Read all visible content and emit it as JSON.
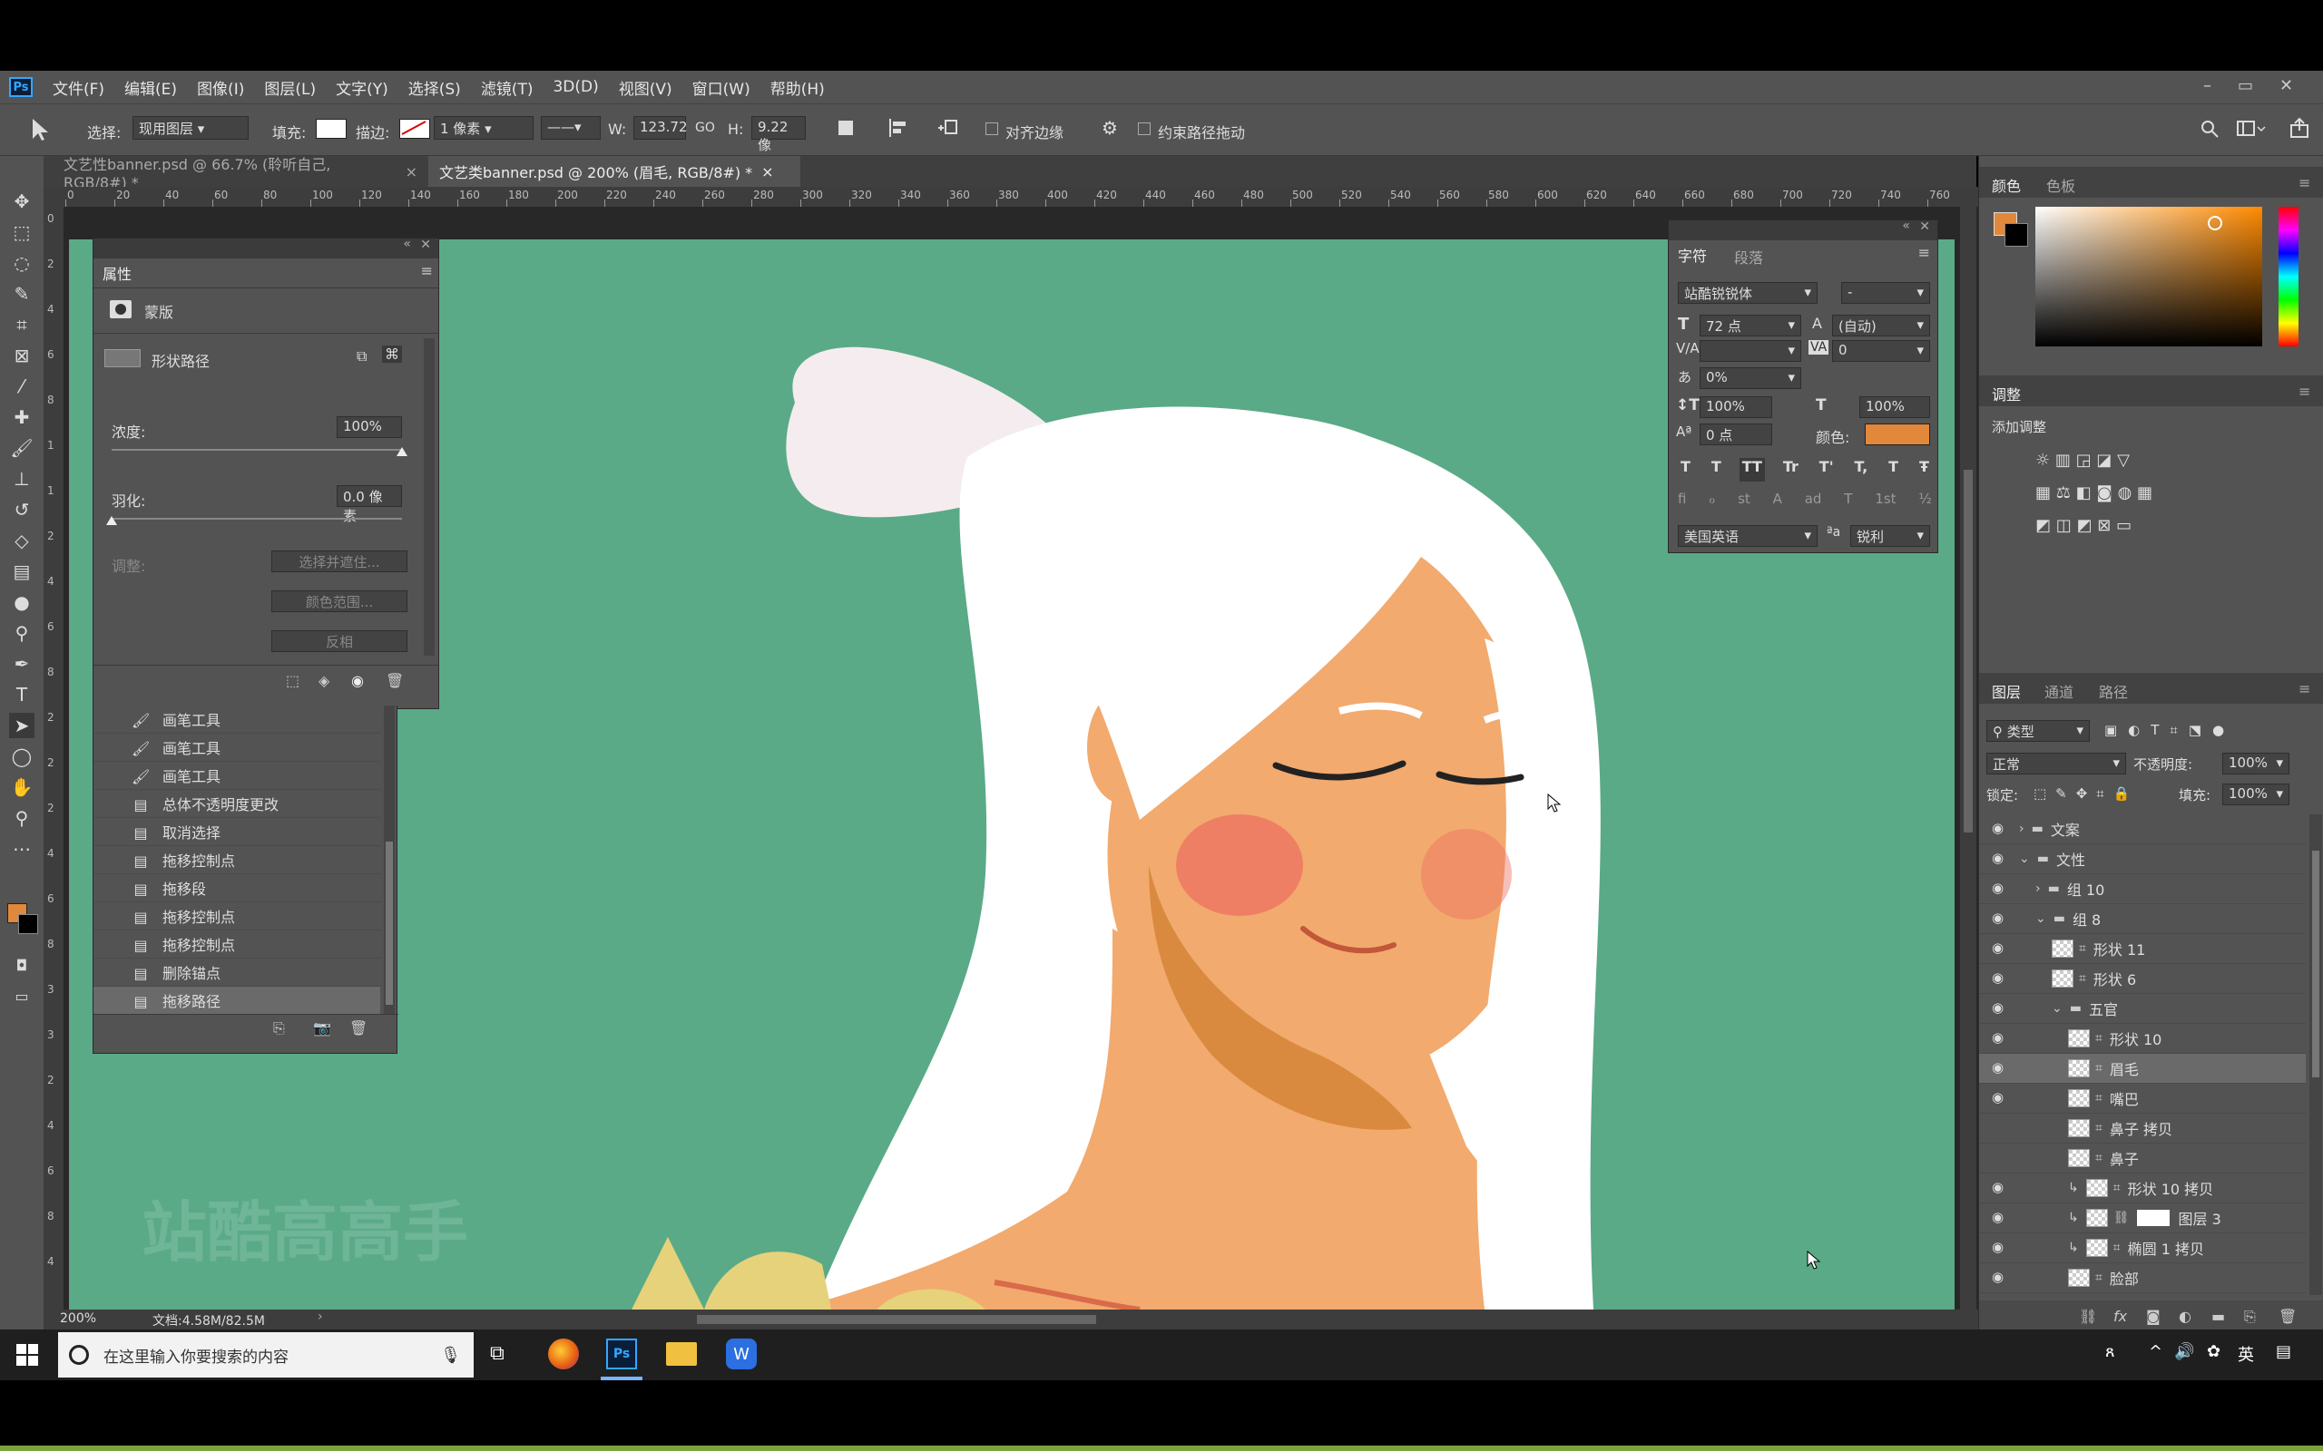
{
  "menu": {
    "app_icon": "Ps",
    "items": [
      "文件(F)",
      "编辑(E)",
      "图像(I)",
      "图层(L)",
      "文字(Y)",
      "选择(S)",
      "滤镜(T)",
      "3D(D)",
      "视图(V)",
      "窗口(W)",
      "帮助(H)"
    ],
    "window_controls": [
      "–",
      "▭",
      "✕"
    ]
  },
  "options": {
    "select_label": "选择:",
    "select_value": "现用图层",
    "fill_label": "填充:",
    "stroke_label": "描边:",
    "stroke_width": "1 像素",
    "w_label": "W:",
    "w_value": "123.72",
    "link": "GO",
    "h_label": "H:",
    "h_value": "9.22 像",
    "align_edges": "对齐边缘",
    "constrain_path": "约束路径拖动"
  },
  "tabs": [
    {
      "label": "文艺性banner.psd @ 66.7% (聆听自己, RGB/8#) *",
      "close": "×"
    },
    {
      "label": "文艺类banner.psd @ 200% (眉毛, RGB/8#) *",
      "close": "×"
    }
  ],
  "ruler_h": [
    "0",
    "20",
    "40",
    "60",
    "80",
    "100",
    "120",
    "140",
    "160",
    "180",
    "200",
    "220",
    "240",
    "260",
    "280",
    "300",
    "320",
    "340",
    "360",
    "380",
    "400",
    "420",
    "440",
    "460",
    "480",
    "500",
    "520",
    "540",
    "560",
    "580",
    "600",
    "620",
    "640",
    "660",
    "680",
    "700",
    "720",
    "740",
    "760"
  ],
  "ruler_v": [
    "0",
    "2",
    "4",
    "6",
    "8",
    "1",
    "1",
    "2",
    "4",
    "6",
    "8",
    "2",
    "2",
    "2",
    "4",
    "6",
    "8",
    "3",
    "3",
    "2",
    "4",
    "6",
    "8",
    "4"
  ],
  "properties": {
    "title": "属性",
    "mask_label": "蒙版",
    "shape_path": "形状路径",
    "density_label": "浓度:",
    "density_value": "100%",
    "density_fraction": 1.0,
    "feather_label": "羽化:",
    "feather_value": "0.0 像素",
    "feather_fraction": 0.0,
    "adjust_label": "调整:",
    "btn_select_mask": "选择并遮住...",
    "btn_color_range": "颜色范围...",
    "btn_invert": "反相"
  },
  "history": {
    "items": [
      "画笔工具",
      "画笔工具",
      "画笔工具",
      "总体不透明度更改",
      "取消选择",
      "拖移控制点",
      "拖移段",
      "拖移控制点",
      "拖移控制点",
      "删除锚点",
      "拖移路径"
    ],
    "selected_index": 10
  },
  "character": {
    "tab_char": "字符",
    "tab_para": "段落",
    "font_family": "站酷锐锐体",
    "font_style": "-",
    "font_size": "72 点",
    "leading": "(自动)",
    "kerning": "",
    "tracking": "0",
    "tsume": "0%",
    "vscale": "100%",
    "hscale": "100%",
    "baseline": "0 点",
    "color_label": "颜色:",
    "color_hex": "#e2883a",
    "styles": [
      "T",
      "T",
      "TT",
      "Tr",
      "T'",
      "T,",
      "T",
      "Ŧ"
    ],
    "ot_features": [
      "fi",
      "ℴ",
      "st",
      "A",
      "ad",
      "T",
      "1st",
      "½"
    ],
    "language": "美国英语",
    "aa_icon": "ªa",
    "aa_mode": "锐利"
  },
  "color_panel": {
    "tab_color": "颜色",
    "tab_swatch": "色板",
    "foreground": "#e2883a",
    "background": "#000000"
  },
  "adjustments": {
    "title": "调整",
    "add_label": "添加调整"
  },
  "layers": {
    "tab_layers": "图层",
    "tab_channels": "通道",
    "tab_paths": "路径",
    "filter_kind": "类型",
    "blend_mode": "正常",
    "opacity_label": "不透明度:",
    "opacity_value": "100%",
    "lock_label": "锁定:",
    "fill_label": "填充:",
    "fill_value": "100%",
    "items": [
      {
        "name": "文案",
        "type": "group",
        "indent": 0,
        "visible": true,
        "expanded": false
      },
      {
        "name": "文性",
        "type": "group",
        "indent": 0,
        "visible": true,
        "expanded": true
      },
      {
        "name": "组 10",
        "type": "group",
        "indent": 1,
        "visible": true,
        "expanded": false
      },
      {
        "name": "组 8",
        "type": "group",
        "indent": 1,
        "visible": true,
        "expanded": true
      },
      {
        "name": "形状 11",
        "type": "shape",
        "indent": 2,
        "visible": true
      },
      {
        "name": "形状 6",
        "type": "shape",
        "indent": 2,
        "visible": true
      },
      {
        "name": "五官",
        "type": "group",
        "indent": 2,
        "visible": true,
        "expanded": true
      },
      {
        "name": "形状 10",
        "type": "shape",
        "indent": 3,
        "visible": true
      },
      {
        "name": "眉毛",
        "type": "shape",
        "indent": 3,
        "visible": true,
        "selected": true
      },
      {
        "name": "嘴巴",
        "type": "shape",
        "indent": 3,
        "visible": true
      },
      {
        "name": "鼻子 拷贝",
        "type": "shape",
        "indent": 3,
        "visible": false
      },
      {
        "name": "鼻子",
        "type": "shape",
        "indent": 3,
        "visible": false
      },
      {
        "name": "形状 10 拷贝",
        "type": "shape",
        "indent": 3,
        "visible": true,
        "clipped": true
      },
      {
        "name": "图层 3",
        "type": "pixel",
        "indent": 3,
        "visible": true,
        "clipped": true
      },
      {
        "name": "椭圆 1 拷贝",
        "type": "shape",
        "indent": 3,
        "visible": true,
        "clipped": true
      },
      {
        "name": "脸部",
        "type": "shape",
        "indent": 3,
        "visible": true
      }
    ]
  },
  "status": {
    "zoom": "200%",
    "doc": "文档:4.58M/82.5M"
  },
  "watermark": "站酷高高手",
  "taskbar": {
    "search_placeholder": "在这里输入你要搜索的内容",
    "tray_lang": "英"
  }
}
